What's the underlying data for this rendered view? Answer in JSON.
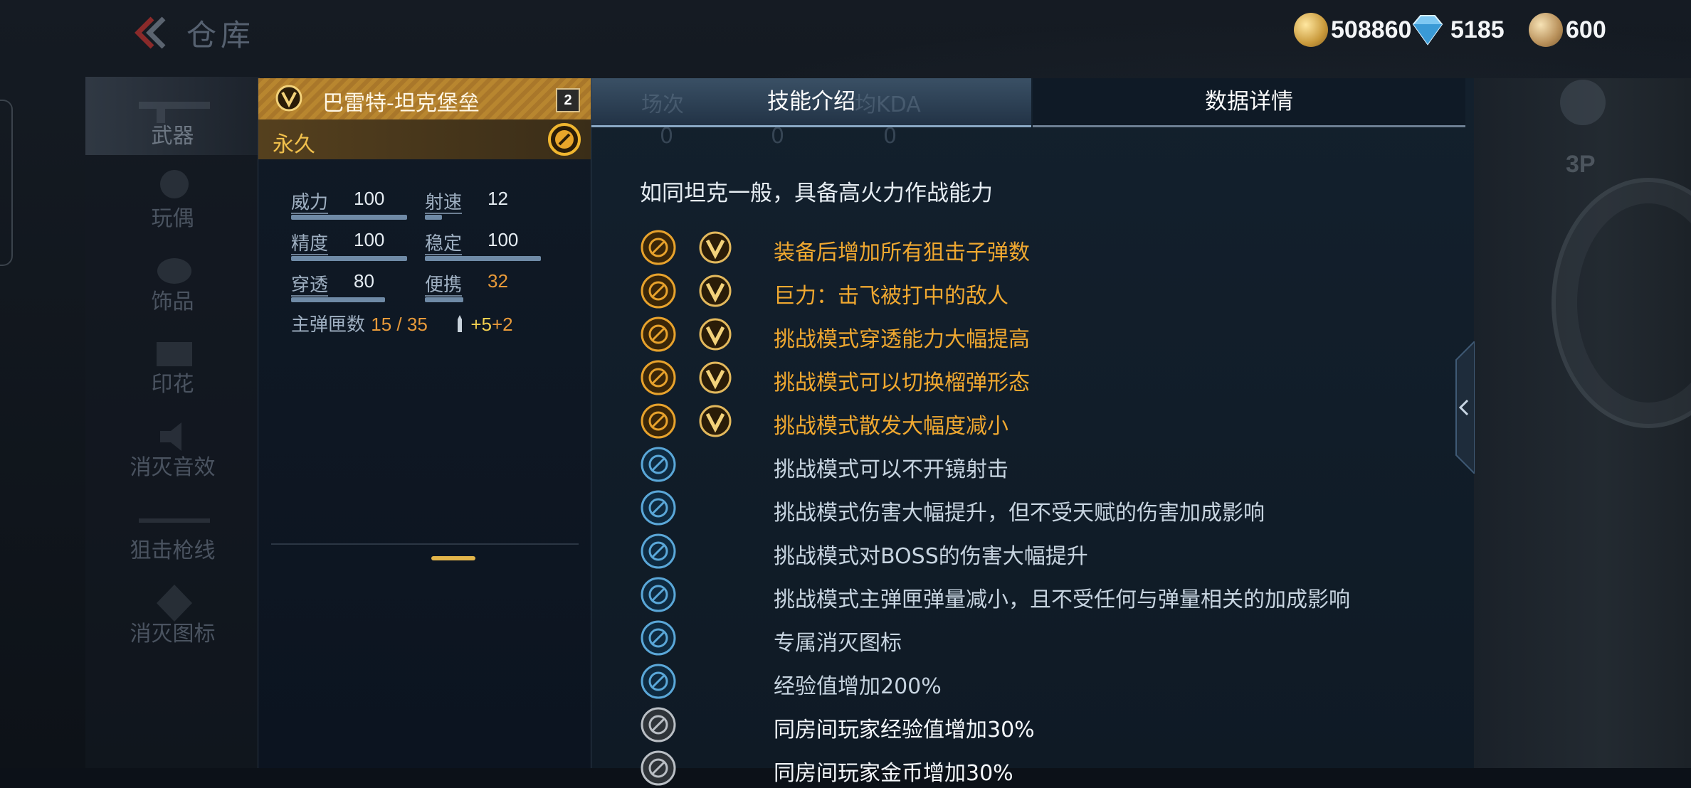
{
  "header": {
    "title": "仓库",
    "currencies": [
      {
        "name": "gold-coin",
        "value": "508860"
      },
      {
        "name": "diamond",
        "value": "5185"
      },
      {
        "name": "medal-coin",
        "value": "600"
      }
    ]
  },
  "nav": {
    "items": [
      {
        "label": "武器"
      },
      {
        "label": "玩偶"
      },
      {
        "label": "饰品"
      },
      {
        "label": "印花"
      },
      {
        "label": "消灭音效"
      },
      {
        "label": "狙击枪线"
      },
      {
        "label": "消灭图标"
      }
    ]
  },
  "weapon": {
    "name": "巴雷特-坦克堡垒",
    "level": "2",
    "duration": "永久",
    "stats": [
      {
        "label": "威力",
        "value": "100",
        "fill": 0.74
      },
      {
        "label": "射速",
        "value": "12",
        "fill": 0.14
      },
      {
        "label": "精度",
        "value": "100",
        "fill": 0.74
      },
      {
        "label": "稳定",
        "value": "100",
        "fill": 0.74
      },
      {
        "label": "穿透",
        "value": "80",
        "fill": 0.6
      },
      {
        "label": "便携",
        "value": "32",
        "fill": 0.24
      }
    ],
    "ammo_label": "主弹匣数",
    "ammo_value": "15 / 35",
    "ammo_bonus_1": "+5",
    "ammo_bonus_2": "+2"
  },
  "tabs": {
    "skill": "技能介绍",
    "data": "数据详情",
    "ghost_headers": [
      "场次",
      "均KDA"
    ],
    "ghost_values": [
      "0",
      "0",
      "0"
    ]
  },
  "skills": {
    "description": "如同坦克一般，具备高火力作战能力",
    "items": [
      {
        "text": "装备后增加所有狙击子弹数",
        "style": "gold",
        "icon": "bullet-icon"
      },
      {
        "text": "巨力：击飞被打中的敌人",
        "style": "gold",
        "icon": "force-icon"
      },
      {
        "text": "挑战模式穿透能力大幅提高",
        "style": "gold",
        "icon": "penetrate-icon"
      },
      {
        "text": "挑战模式可以切换榴弹形态",
        "style": "gold",
        "icon": "grenade-icon"
      },
      {
        "text": "挑战模式散发大幅度减小",
        "style": "gold",
        "icon": "spread-icon"
      },
      {
        "text": "挑战模式可以不开镜射击",
        "style": "blue",
        "icon": "noscope-icon"
      },
      {
        "text": "挑战模式伤害大幅提升，但不受天赋的伤害加成影响",
        "style": "blue",
        "icon": "damage-up-icon"
      },
      {
        "text": "挑战模式对BOSS的伤害大幅提升",
        "style": "blue",
        "icon": "boss-damage-icon"
      },
      {
        "text": "挑战模式主弹匣弹量减小，且不受任何与弹量相关的加成影响",
        "style": "blue",
        "icon": "crosshair-icon"
      },
      {
        "text": "专属消灭图标",
        "style": "blue",
        "icon": "kill-icon"
      },
      {
        "text": "经验值增加200%",
        "style": "blue",
        "icon": "exp-icon"
      },
      {
        "text": "同房间玩家经验值增加30%",
        "style": "white",
        "icon": "room-exp-icon"
      },
      {
        "text": "同房间玩家金币增加30%",
        "style": "white",
        "icon": "room-coin-icon"
      }
    ]
  },
  "side": {
    "camera": "3P"
  },
  "colors": {
    "gold_text": "#f0a830",
    "blue_text": "#c7d4e0",
    "header_gold": "#b8862f"
  }
}
